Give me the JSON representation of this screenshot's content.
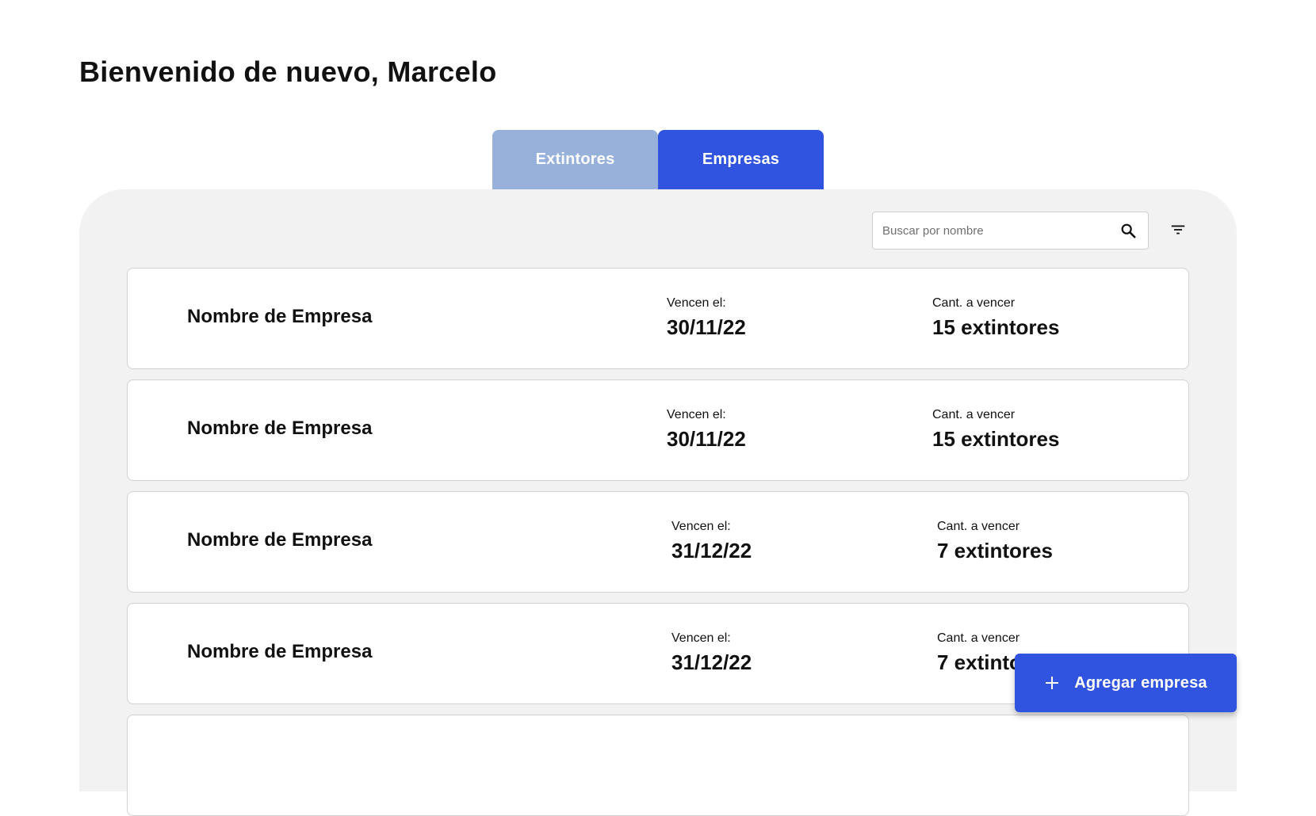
{
  "header": {
    "title": "Bienvenido de nuevo, Marcelo"
  },
  "tabs": [
    {
      "label": "Extintores",
      "active": false
    },
    {
      "label": "Empresas",
      "active": true
    }
  ],
  "colors": {
    "accent": "#3053e0",
    "tab_inactive": "#97b1db",
    "panel_background": "#f2f2f2"
  },
  "search": {
    "placeholder": "Buscar por nombre",
    "value": "",
    "icon": "search-icon"
  },
  "filter": {
    "icon": "filter-icon"
  },
  "companies": [
    {
      "name": "Nombre de Empresa",
      "due_label": "Vencen el:",
      "due_date": "30/11/22",
      "count_label": "Cant. a vencer",
      "count": "15 extintores"
    },
    {
      "name": "Nombre de Empresa",
      "due_label": "Vencen el:",
      "due_date": "30/11/22",
      "count_label": "Cant. a vencer",
      "count": "15 extintores"
    },
    {
      "name": "Nombre de Empresa",
      "due_label": "Vencen el:",
      "due_date": "31/12/22",
      "count_label": "Cant. a vencer",
      "count": "7 extintores"
    },
    {
      "name": "Nombre de Empresa",
      "due_label": "Vencen el:",
      "due_date": "31/12/22",
      "count_label": "Cant. a vencer",
      "count": "7 extintores"
    }
  ],
  "add_button": {
    "label": "Agregar empresa",
    "icon": "plus-icon"
  }
}
